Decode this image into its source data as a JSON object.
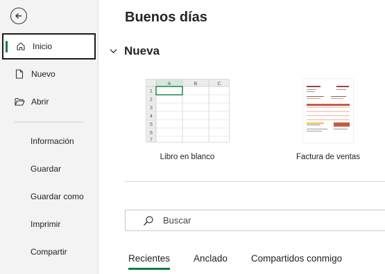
{
  "sidebar": {
    "items": [
      {
        "label": "Inicio",
        "icon": "home-icon"
      },
      {
        "label": "Nuevo",
        "icon": "new-file-icon"
      },
      {
        "label": "Abrir",
        "icon": "folder-open-icon"
      }
    ],
    "text_items": [
      "Información",
      "Guardar",
      "Guardar como",
      "Imprimir",
      "Compartir"
    ]
  },
  "main": {
    "greeting": "Buenos días",
    "new_section": "Nueva",
    "templates": [
      {
        "label": "Libro en blanco"
      },
      {
        "label": "Factura de ventas"
      }
    ],
    "blank_sheet": {
      "columns": [
        "A",
        "B",
        "C"
      ],
      "rows": [
        "1",
        "2",
        "3",
        "4",
        "5",
        "6",
        "7"
      ]
    },
    "search_placeholder": "Buscar",
    "tabs": [
      "Recientes",
      "Anclado",
      "Compartidos conmigo"
    ]
  },
  "colors": {
    "accent": "#107c41",
    "sidebar_bg": "#f3f3f3"
  }
}
